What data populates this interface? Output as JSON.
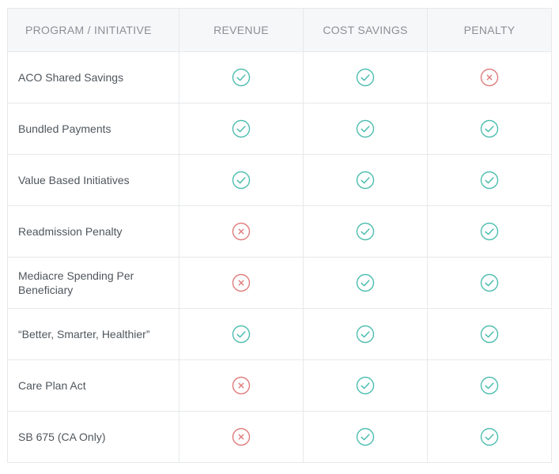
{
  "colors": {
    "check": "#4dbdaf",
    "cross": "#e07b7b",
    "header_bg": "#f6f7f8",
    "border": "#e6e8ea"
  },
  "headers": [
    "PROGRAM / INITIATIVE",
    "REVENUE",
    "COST SAVINGS",
    "PENALTY"
  ],
  "rows": [
    {
      "name": "ACO Shared Savings",
      "revenue": "check-icon",
      "cost_savings": "check-icon",
      "penalty": "cross-icon"
    },
    {
      "name": "Bundled Payments",
      "revenue": "check-icon",
      "cost_savings": "check-icon",
      "penalty": "check-icon"
    },
    {
      "name": "Value Based Initiatives",
      "revenue": "check-icon",
      "cost_savings": "check-icon",
      "penalty": "check-icon"
    },
    {
      "name": "Readmission Penalty",
      "revenue": "cross-icon",
      "cost_savings": "check-icon",
      "penalty": "check-icon"
    },
    {
      "name": "Mediacre Spending Per Beneficiary",
      "revenue": "cross-icon",
      "cost_savings": "check-icon",
      "penalty": "check-icon"
    },
    {
      "name": "“Better, Smarter, Healthier”",
      "revenue": "check-icon",
      "cost_savings": "check-icon",
      "penalty": "check-icon"
    },
    {
      "name": "Care Plan Act",
      "revenue": "cross-icon",
      "cost_savings": "check-icon",
      "penalty": "check-icon"
    },
    {
      "name": "SB 675 (CA Only)",
      "revenue": "cross-icon",
      "cost_savings": "check-icon",
      "penalty": "check-icon"
    }
  ]
}
